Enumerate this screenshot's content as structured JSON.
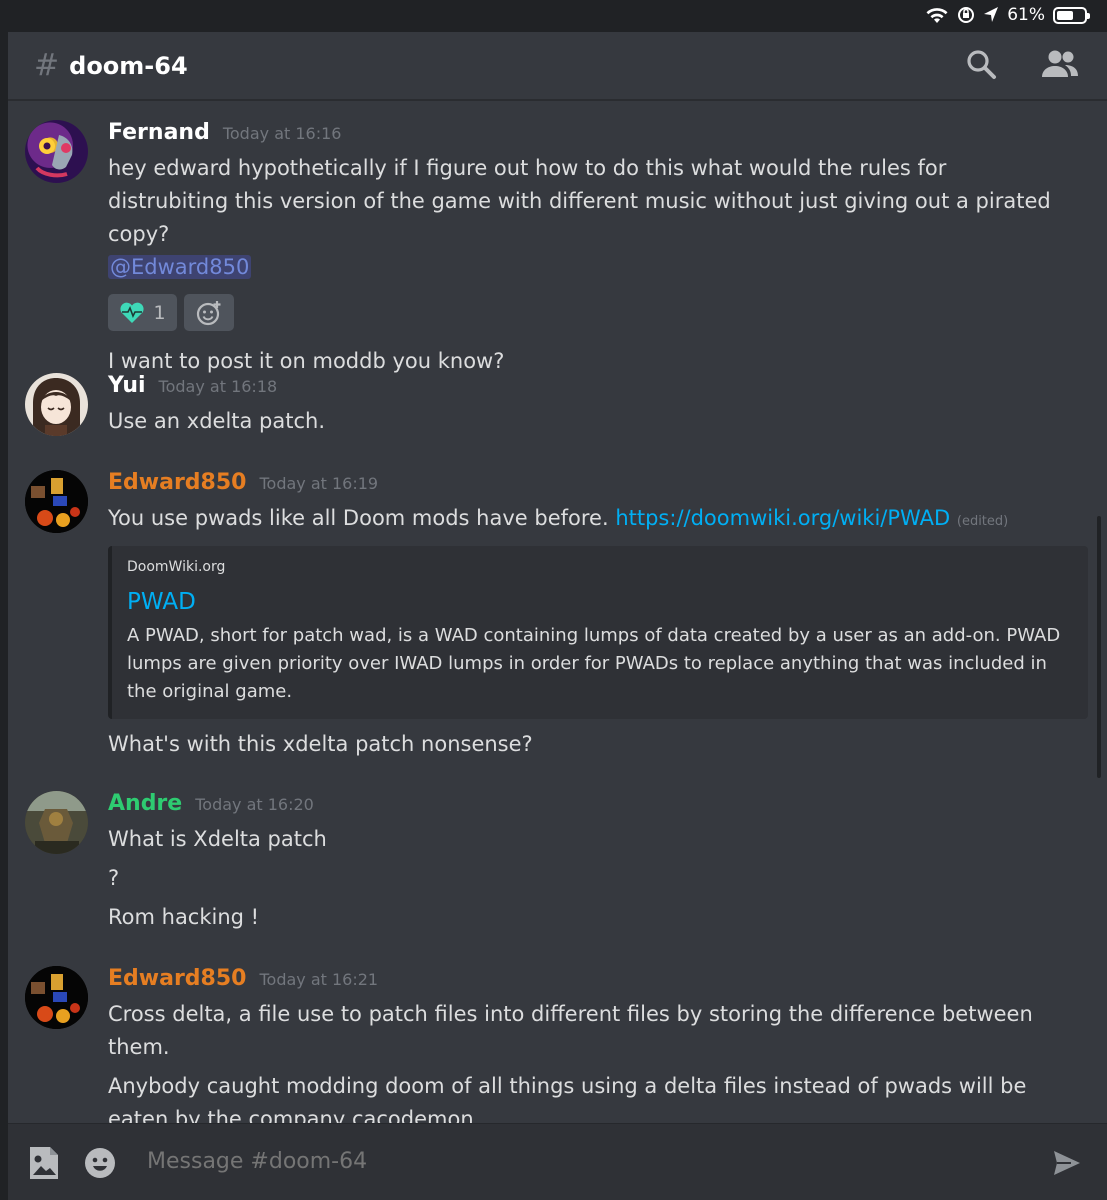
{
  "status_bar": {
    "battery_percent": "61%",
    "battery_level": 0.61
  },
  "header": {
    "hash": "#",
    "channel_name": "doom-64"
  },
  "messages": [
    {
      "author": "Fernand",
      "author_color": "#ffffff",
      "timestamp": "Today at 16:16",
      "lines": [
        "hey edward hypothetically if I figure out how to do this what would the rules for distrubiting this version of the game with different music without just giving out a pirated copy?"
      ],
      "mention": "@Edward850",
      "reaction": {
        "emoji": "heart-pulse",
        "count": "1"
      },
      "followup": "I want to post it on moddb you know?"
    },
    {
      "author": "Yui",
      "author_color": "#ffffff",
      "timestamp": "Today at 16:18",
      "lines": [
        "Use an xdelta patch."
      ]
    },
    {
      "author": "Edward850",
      "author_color": "#e67e22",
      "timestamp": "Today at 16:19",
      "text_before_link": "You use pwads like all Doom mods have before.",
      "link": "https://doomwiki.org/wiki/PWAD",
      "edited": "(edited)",
      "embed": {
        "provider": "DoomWiki.org",
        "title": "PWAD",
        "description": "A PWAD, short for patch wad, is a WAD containing lumps of data created by a user as an add-on. PWAD lumps are given priority over IWAD lumps in order for PWADs to replace anything that was included in the original game."
      },
      "followup": "What's with this xdelta patch nonsense?"
    },
    {
      "author": "Andre",
      "author_color": "#2ecc71",
      "timestamp": "Today at 16:20",
      "lines": [
        "What is Xdelta patch",
        "?",
        "Rom hacking !"
      ]
    },
    {
      "author": "Edward850",
      "author_color": "#e67e22",
      "timestamp": "Today at 16:21",
      "lines": [
        "Cross delta, a file use to patch files into different files by storing the difference between them.",
        "Anybody caught modding doom of all things using a delta files instead of pwads will be eaten by the company cacodemon."
      ]
    }
  ],
  "composer": {
    "placeholder": "Message #doom-64"
  },
  "colors": {
    "background": "#36393f",
    "link": "#00aff4",
    "mention": "#7289da"
  }
}
